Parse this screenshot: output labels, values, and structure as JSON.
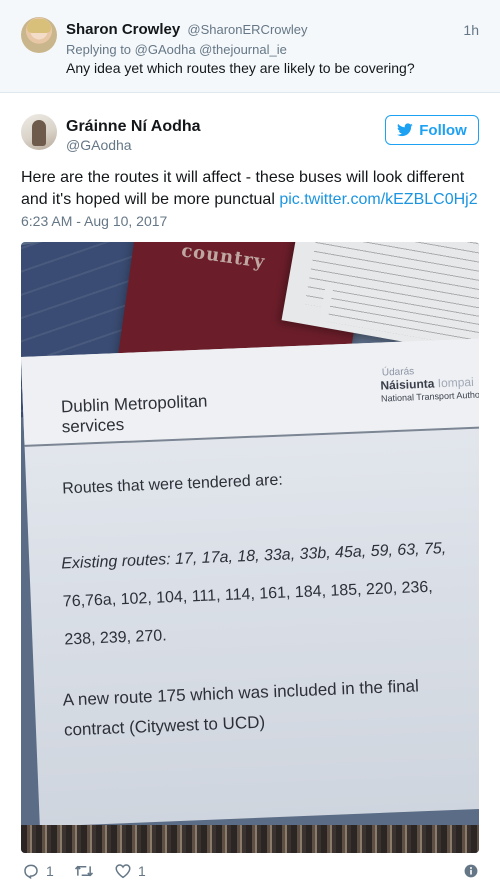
{
  "reply_tweet": {
    "name": "Sharon Crowley",
    "handle": "@SharonERCrowley",
    "time": "1h",
    "replying_prefix": "Replying to",
    "replying_to": "@GAodha @thejournal_ie",
    "text": "Any idea yet which routes they are likely to be covering?"
  },
  "main_tweet": {
    "name": "Gráinne Ní Aodha",
    "handle": "@GAodha",
    "follow_label": "Follow",
    "text_line1": "Here are the routes it will affect - these buses will look different",
    "text_line2": "and it's hoped will be more punctual",
    "pic_link": "pic.twitter.com/kEZBLC0Hj2",
    "timestamp": "6:23 AM - Aug 10, 2017"
  },
  "photo": {
    "passport_text": "country",
    "header_line1": "Dublin Metropolitan",
    "header_line2": "services",
    "agency_line1": "Údarás",
    "agency_line2_main": "Náisiunta",
    "agency_line2_faint": " Iompai",
    "agency_line3": "National Transport Authori",
    "tendered_heading": "Routes that were tendered are:",
    "routes_line1": "Existing routes: 17, 17a, 18, 33a, 33b, 45a, 59, 63, 75,",
    "routes_line2": "76,76a, 102, 104, 111, 114, 161, 184, 185, 220, 236,",
    "routes_line3": "238, 239, 270.",
    "new_route_line1": "A new route 175 which was included in the final",
    "new_route_line2": "contract (Citywest to UCD)"
  },
  "actions": {
    "reply_count": "1",
    "like_count": "1"
  },
  "colors": {
    "accent": "#1da1f2",
    "link": "#1b95e0",
    "secondary_text": "#657786",
    "primary_text": "#14171a",
    "reply_bg": "#f5f8fa"
  },
  "icons": [
    "twitter-bird-icon",
    "reply-icon",
    "retweet-icon",
    "heart-icon",
    "info-icon"
  ]
}
